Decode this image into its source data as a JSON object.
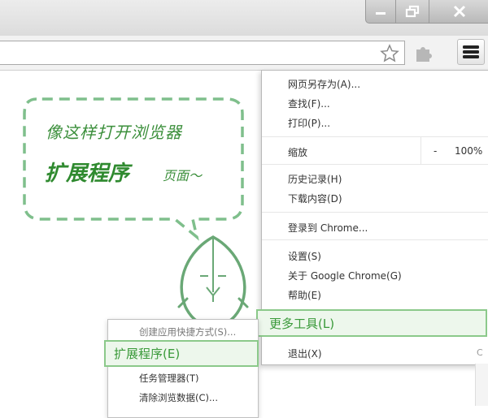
{
  "window": {
    "minimize_icon": "minimize-icon",
    "maximize_icon": "restore-icon",
    "close_icon": "close-icon"
  },
  "toolbar": {
    "bookmark_icon": "star-icon",
    "extension_icon": "puzzle-icon",
    "menu_icon": "hamburger-menu-icon"
  },
  "menu": {
    "save_page": "网页另存为(A)...",
    "find": "查找(F)...",
    "print": "打印(P)...",
    "zoom_label": "缩放",
    "zoom_minus": "-",
    "zoom_value": "100%",
    "history": "历史记录(H)",
    "downloads": "下载内容(D)",
    "sign_in": "登录到 Chrome...",
    "settings": "设置(S)",
    "about": "关于 Google Chrome(G)",
    "help": "帮助(E)",
    "more_tools": "更多工具(L)",
    "exit": "退出(X)"
  },
  "submenu": {
    "create_shortcut": "创建应用快捷方式(S)...",
    "extensions": "扩展程序(E)",
    "task_manager": "任务管理器(T)",
    "clear_data": "清除浏览数据(C)..."
  },
  "annotation": {
    "line1": "像这样打开浏览器",
    "line2": "扩展程序",
    "line3": "页面～"
  },
  "colors": {
    "accent_green": "#3a9a3a",
    "highlight_bg": "#edf7ec",
    "highlight_border": "#8bc98a",
    "bubble_stroke": "#7fbf8c"
  }
}
